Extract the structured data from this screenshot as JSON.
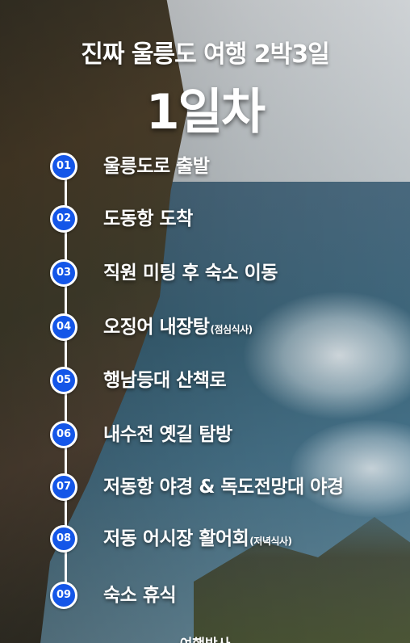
{
  "header": {
    "subtitle": "진짜 울릉도 여행 2박3일",
    "title": "1일차"
  },
  "steps": [
    {
      "number": "01",
      "label": "울릉도로 출발",
      "note": ""
    },
    {
      "number": "02",
      "label": "도동항 도착",
      "note": ""
    },
    {
      "number": "03",
      "label": "직원 미팅 후 숙소 이동",
      "note": ""
    },
    {
      "number": "04",
      "label": "오징어 내장탕",
      "note": "(점심식사)"
    },
    {
      "number": "05",
      "label": "행남등대 산책로",
      "note": ""
    },
    {
      "number": "06",
      "label": "내수전 옛길 탐방",
      "note": ""
    },
    {
      "number": "07",
      "label": "저동항 야경 & 독도전망대 야경",
      "note": ""
    },
    {
      "number": "08",
      "label": "저동 어시장 활어회",
      "note": "(저녁식사)"
    },
    {
      "number": "09",
      "label": "숙소 휴식",
      "note": ""
    }
  ],
  "footer": {
    "text": "여행박사"
  },
  "colors": {
    "badge": "#1456e8",
    "text": "#ffffff"
  }
}
